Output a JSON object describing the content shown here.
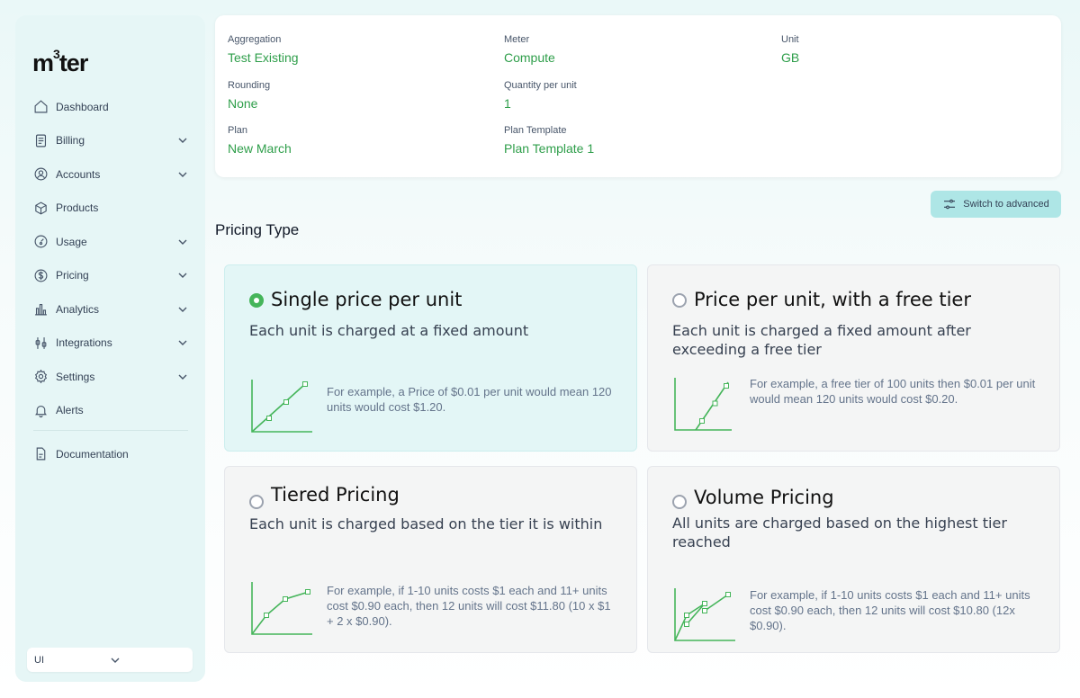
{
  "brand": {
    "logo_text": "m",
    "logo_sup": "3",
    "logo_rest": "ter"
  },
  "sidebar": {
    "items": [
      {
        "label": "Dashboard",
        "icon": "home-icon",
        "expandable": false
      },
      {
        "label": "Billing",
        "icon": "receipt-icon",
        "expandable": true
      },
      {
        "label": "Accounts",
        "icon": "user-circle-icon",
        "expandable": true
      },
      {
        "label": "Products",
        "icon": "package-icon",
        "expandable": false
      },
      {
        "label": "Usage",
        "icon": "gauge-icon",
        "expandable": true
      },
      {
        "label": "Pricing",
        "icon": "dollar-circle-icon",
        "expandable": true
      },
      {
        "label": "Analytics",
        "icon": "bar-chart-icon",
        "expandable": true
      },
      {
        "label": "Integrations",
        "icon": "sliders-icon",
        "expandable": true
      },
      {
        "label": "Settings",
        "icon": "gear-icon",
        "expandable": true
      },
      {
        "label": "Alerts",
        "icon": "bell-icon",
        "expandable": false
      }
    ],
    "documentation": "Documentation",
    "env_select": "UI"
  },
  "info": {
    "aggregation": {
      "label": "Aggregation",
      "value": "Test Existing"
    },
    "meter": {
      "label": "Meter",
      "value": "Compute"
    },
    "unit": {
      "label": "Unit",
      "value": "GB"
    },
    "rounding": {
      "label": "Rounding",
      "value": "None"
    },
    "quantity": {
      "label": "Quantity per unit",
      "value": "1"
    },
    "plan": {
      "label": "Plan",
      "value": "New March"
    },
    "plan_template": {
      "label": "Plan Template",
      "value": "Plan Template 1"
    }
  },
  "advanced_button": "Switch to advanced",
  "section_title": "Pricing Type",
  "pricing_options": [
    {
      "title": "Single price per unit",
      "desc": "Each unit is charged at a fixed amount",
      "example": "For example, a Price of $0.01 per unit would mean 120 units would cost $1.20.",
      "selected": true
    },
    {
      "title": "Price per unit, with a free tier",
      "desc": "Each unit is charged a fixed amount after exceeding a free tier",
      "example": "For example, a free tier of 100 units then $0.01 per unit would mean 120 units would cost $0.20.",
      "selected": false
    },
    {
      "title": "Tiered Pricing",
      "desc": "Each unit is charged based on the tier it is within",
      "example": "For example, if 1-10 units costs $1 each and 11+ units cost $0.90 each, then 12 units will cost $11.80 (10 x $1 + 2 x $0.90).",
      "selected": false
    },
    {
      "title": "Volume Pricing",
      "desc": "All units are charged based on the highest tier reached",
      "example": "For example, if 1-10 units costs $1 each and 11+ units cost $0.90 each, then 12 units will cost $10.80 (12x $0.90).",
      "selected": false
    }
  ],
  "colors": {
    "accent_green": "#2e9e4a",
    "selected_card": "#e3f6f6",
    "sidebar_bg": "#e6f6f6"
  }
}
